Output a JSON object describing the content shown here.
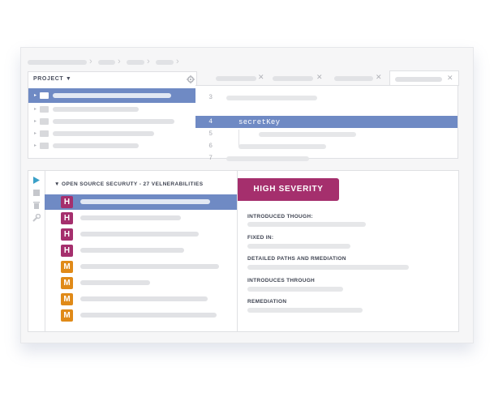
{
  "project_panel": {
    "title": "PROJECT",
    "dropdown_icon": "caret-down-icon",
    "settings_icon": "gear-icon"
  },
  "editor": {
    "line_numbers": [
      "3",
      "4",
      "5",
      "6",
      "7"
    ],
    "highlighted_code": "secretKey"
  },
  "side_toolbar": {
    "icons": [
      "play-icon",
      "stop-icon",
      "trash-icon",
      "wrench-icon"
    ]
  },
  "vulnerabilities": {
    "title": "OPEN SOURCE SECURUTY - 27 VELNERABILITIES",
    "items": [
      {
        "severity": "H"
      },
      {
        "severity": "H"
      },
      {
        "severity": "H"
      },
      {
        "severity": "H"
      },
      {
        "severity": "M"
      },
      {
        "severity": "M"
      },
      {
        "severity": "M"
      },
      {
        "severity": "M"
      }
    ]
  },
  "details": {
    "severity_label": "HIGH SEVERITY",
    "introduced_though_label": "INTRODUCED THOUGH:",
    "fixed_in_label": "FIXED IN:",
    "detailed_paths_label": "DETAILED PATHS AND RMEDIATION",
    "introduces_through_label": "INTRODUCES THROUGH",
    "remediation_label": "REMEDIATION"
  },
  "colors": {
    "high": "#a52f6d",
    "medium": "#e08a18",
    "selection": "#6f8ac4"
  }
}
